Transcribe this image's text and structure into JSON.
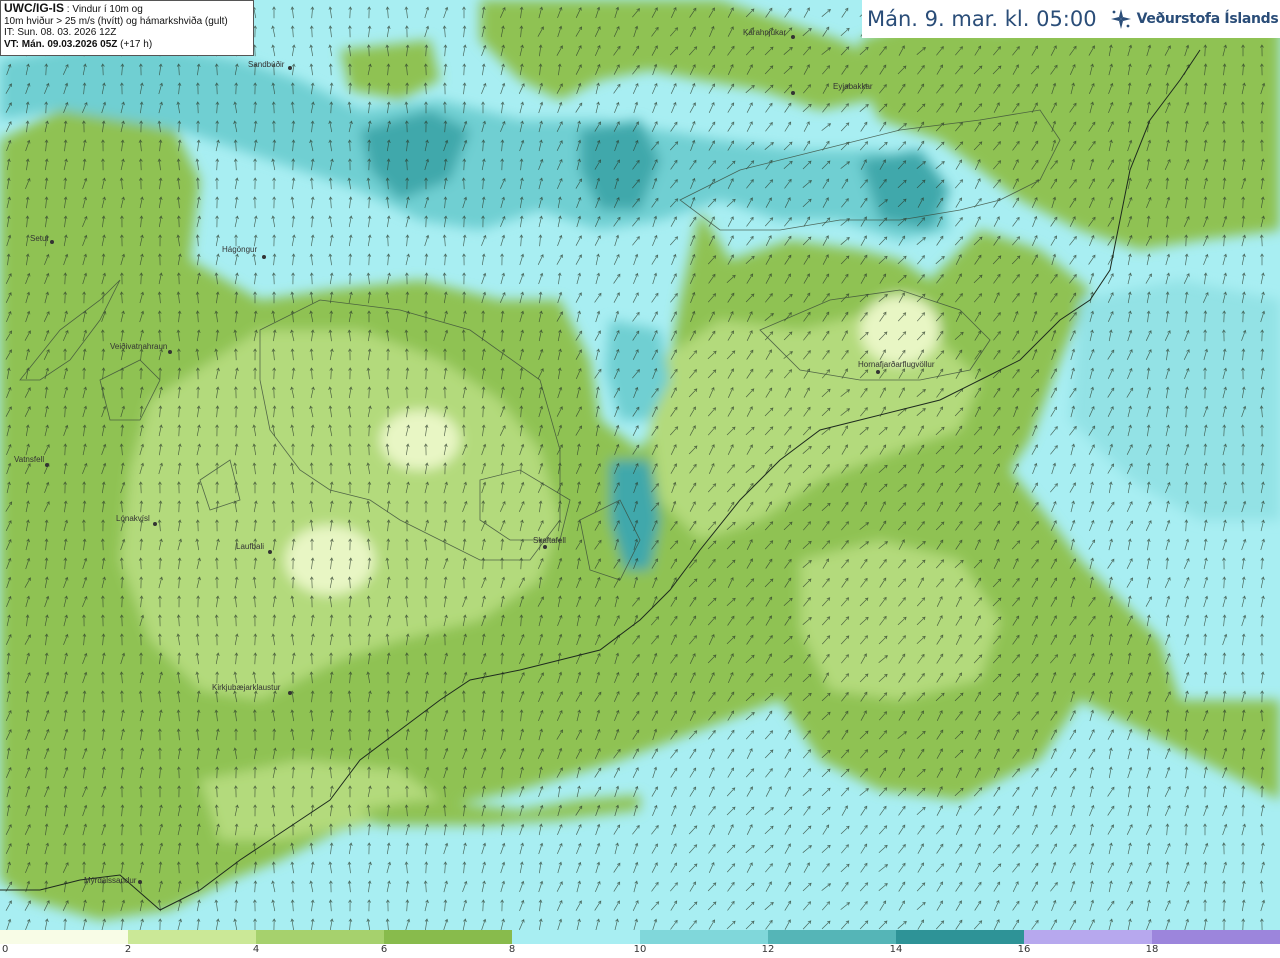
{
  "info": {
    "model": "UWC/IG-IS",
    "line1_rest": " : Vindur í 10m og",
    "line2": "10m hviður > 25 m/s (hvítt) og hámarkshviða (gult)",
    "line3": "IT: Sun. 08. 03. 2026 12Z",
    "vt_label": "VT: Mán. 09.03.2026 05Z",
    "vt_offset": " (+17 h)"
  },
  "title": "Mán. 9. mar. kl. 05:00",
  "logo": {
    "text": "Veðurstofa Íslands",
    "icon": "vedurstofa-logo-icon"
  },
  "legend": {
    "ticks": [
      "0",
      "2",
      "4",
      "6",
      "8",
      "10",
      "12",
      "14",
      "16",
      "18"
    ],
    "colors": [
      "#f8fce6",
      "#cbe897",
      "#a6d16d",
      "#88bb4c",
      "#a8eef2",
      "#80d7da",
      "#55b5b7",
      "#2e9397",
      "#b7a8ee",
      "#9c85dc"
    ]
  },
  "places": [
    {
      "name": "Sandbúðir"
    },
    {
      "name": "Kárahnjúkar"
    },
    {
      "name": "Eyjabakkar"
    },
    {
      "name": "Setur"
    },
    {
      "name": "Hágöngur"
    },
    {
      "name": "Veiðivatnahraun"
    },
    {
      "name": "Hornafjarðarflugvöllur"
    },
    {
      "name": "Vatnsfell"
    },
    {
      "name": "Lónakvísl"
    },
    {
      "name": "Laufbali"
    },
    {
      "name": "Skaftafell"
    },
    {
      "name": "Kirkjubæjarklaustur"
    },
    {
      "name": "Mýrdalssandur"
    }
  ]
}
